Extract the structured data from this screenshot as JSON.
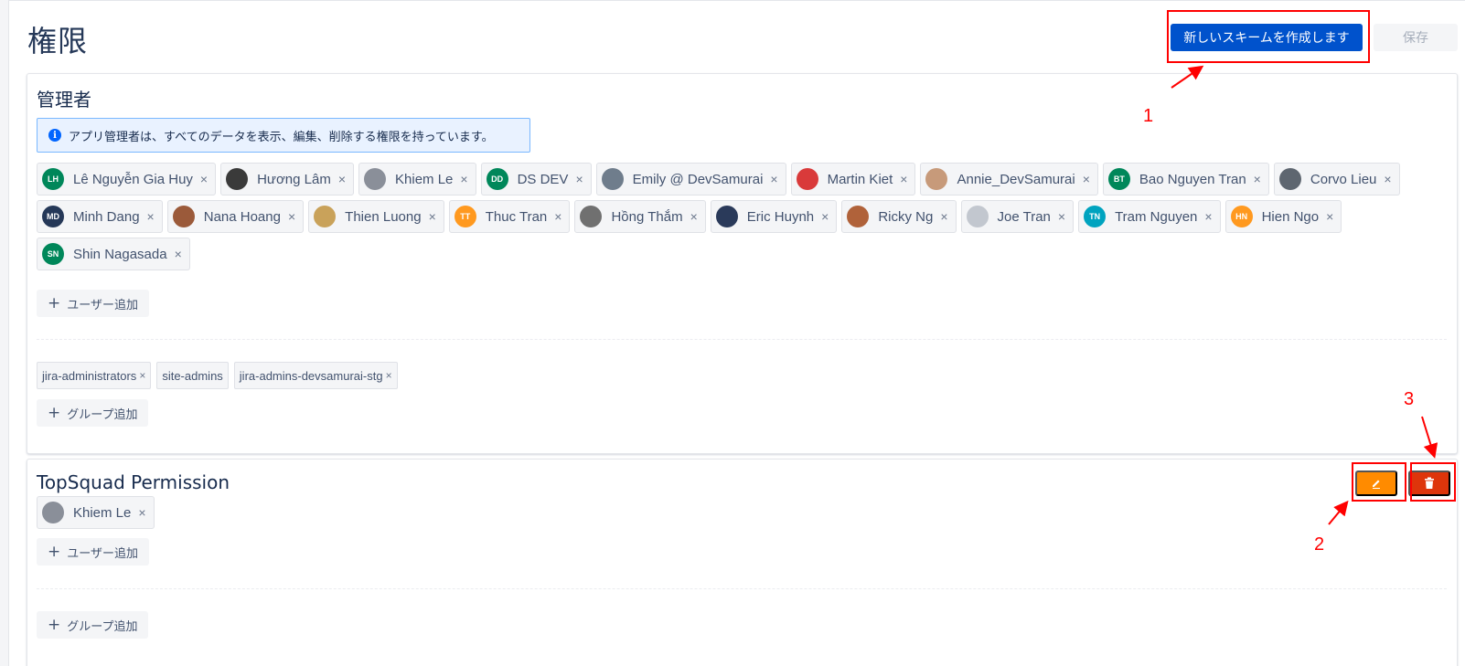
{
  "page": {
    "title": "権限",
    "create_scheme_label": "新しいスキームを作成します",
    "save_label": "保存"
  },
  "admin_section": {
    "title": "管理者",
    "info_text": "アプリ管理者は、すべてのデータを表示、編集、削除する権限を持っています。",
    "users": [
      {
        "name": "Lê Nguyễn Gia Huy",
        "initials": "LH",
        "color": "#00875a"
      },
      {
        "name": "Hương Lâm",
        "initials": "",
        "color": "#3a3a3a"
      },
      {
        "name": "Khiem Le",
        "initials": "",
        "color": "#8a8f99"
      },
      {
        "name": "DS DEV",
        "initials": "DD",
        "color": "#00875a"
      },
      {
        "name": "Emily @ DevSamurai",
        "initials": "",
        "color": "#6f7d8c"
      },
      {
        "name": "Martin Kiet",
        "initials": "",
        "color": "#d93a3a"
      },
      {
        "name": "Annie_DevSamurai",
        "initials": "",
        "color": "#c79a7a"
      },
      {
        "name": "Bao Nguyen Tran",
        "initials": "BT",
        "color": "#00875a"
      },
      {
        "name": "Corvo Lieu",
        "initials": "",
        "color": "#5e6670"
      },
      {
        "name": "Minh Dang",
        "initials": "MD",
        "color": "#253858"
      },
      {
        "name": "Nana Hoang",
        "initials": "",
        "color": "#9b5a3a"
      },
      {
        "name": "Thien Luong",
        "initials": "",
        "color": "#c9a25a"
      },
      {
        "name": "Thuc Tran",
        "initials": "TT",
        "color": "#ff991f"
      },
      {
        "name": "Hồng Thắm",
        "initials": "",
        "color": "#707070"
      },
      {
        "name": "Eric Huynh",
        "initials": "",
        "color": "#2a3a5a"
      },
      {
        "name": "Ricky Ng",
        "initials": "",
        "color": "#b0623a"
      },
      {
        "name": "Joe Tran",
        "initials": "",
        "color": "#c2c7cf"
      },
      {
        "name": "Tram Nguyen",
        "initials": "TN",
        "color": "#00a3bf"
      },
      {
        "name": "Hien Ngo",
        "initials": "HN",
        "color": "#ff991f"
      },
      {
        "name": "Shin Nagasada",
        "initials": "SN",
        "color": "#00875a"
      }
    ],
    "add_user_label": "ユーザー追加",
    "groups": [
      "jira-administrators",
      "site-admins",
      "jira-admins-devsamurai-stg"
    ],
    "removable_groups": [
      true,
      false,
      true
    ],
    "add_group_label": "グループ追加"
  },
  "topsquad_section": {
    "title": "TopSquad Permission",
    "users": [
      {
        "name": "Khiem Le",
        "initials": "",
        "color": "#8a8f99"
      }
    ],
    "add_user_label": "ユーザー追加",
    "add_group_label": "グループ追加"
  },
  "annotations": {
    "labels": [
      "1",
      "2",
      "3"
    ],
    "color": "#ff0000"
  },
  "icons": {
    "info": "info-icon",
    "remove": "close-icon",
    "add": "plus-icon",
    "edit": "pencil-icon",
    "delete": "trash-icon"
  }
}
